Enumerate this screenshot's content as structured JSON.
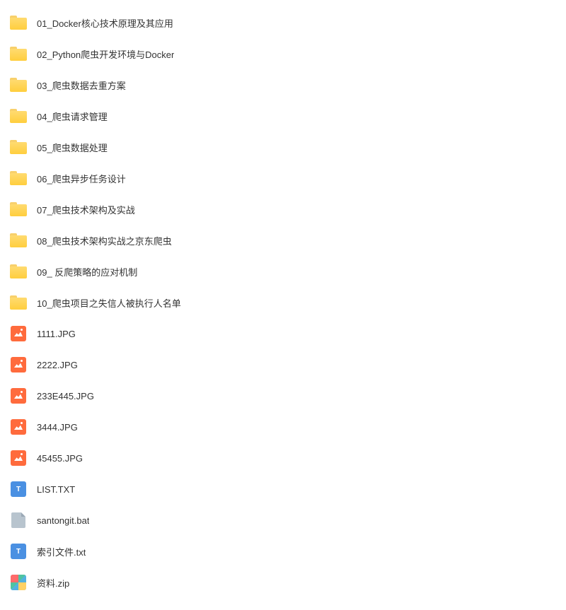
{
  "files": [
    {
      "name": "01_Docker核心技术原理及其应用",
      "type": "folder"
    },
    {
      "name": "02_Python爬虫开发环境与Docker",
      "type": "folder"
    },
    {
      "name": "03_爬虫数据去重方案",
      "type": "folder"
    },
    {
      "name": "04_爬虫请求管理",
      "type": "folder"
    },
    {
      "name": "05_爬虫数据处理",
      "type": "folder"
    },
    {
      "name": "06_爬虫异步任务设计",
      "type": "folder"
    },
    {
      "name": "07_爬虫技术架构及实战",
      "type": "folder"
    },
    {
      "name": "08_爬虫技术架构实战之京东爬虫",
      "type": "folder"
    },
    {
      "name": "09_ 反爬策略的应对机制",
      "type": "folder"
    },
    {
      "name": "10_爬虫项目之失信人被执行人名单",
      "type": "folder"
    },
    {
      "name": "1111.JPG",
      "type": "image"
    },
    {
      "name": "2222.JPG",
      "type": "image"
    },
    {
      "name": "233E445.JPG",
      "type": "image"
    },
    {
      "name": "3444.JPG",
      "type": "image"
    },
    {
      "name": "45455.JPG",
      "type": "image"
    },
    {
      "name": "LIST.TXT",
      "type": "text"
    },
    {
      "name": "santongit.bat",
      "type": "bat"
    },
    {
      "name": "索引文件.txt",
      "type": "text"
    },
    {
      "name": "资料.zip",
      "type": "zip"
    }
  ],
  "iconLabels": {
    "text": "T"
  }
}
